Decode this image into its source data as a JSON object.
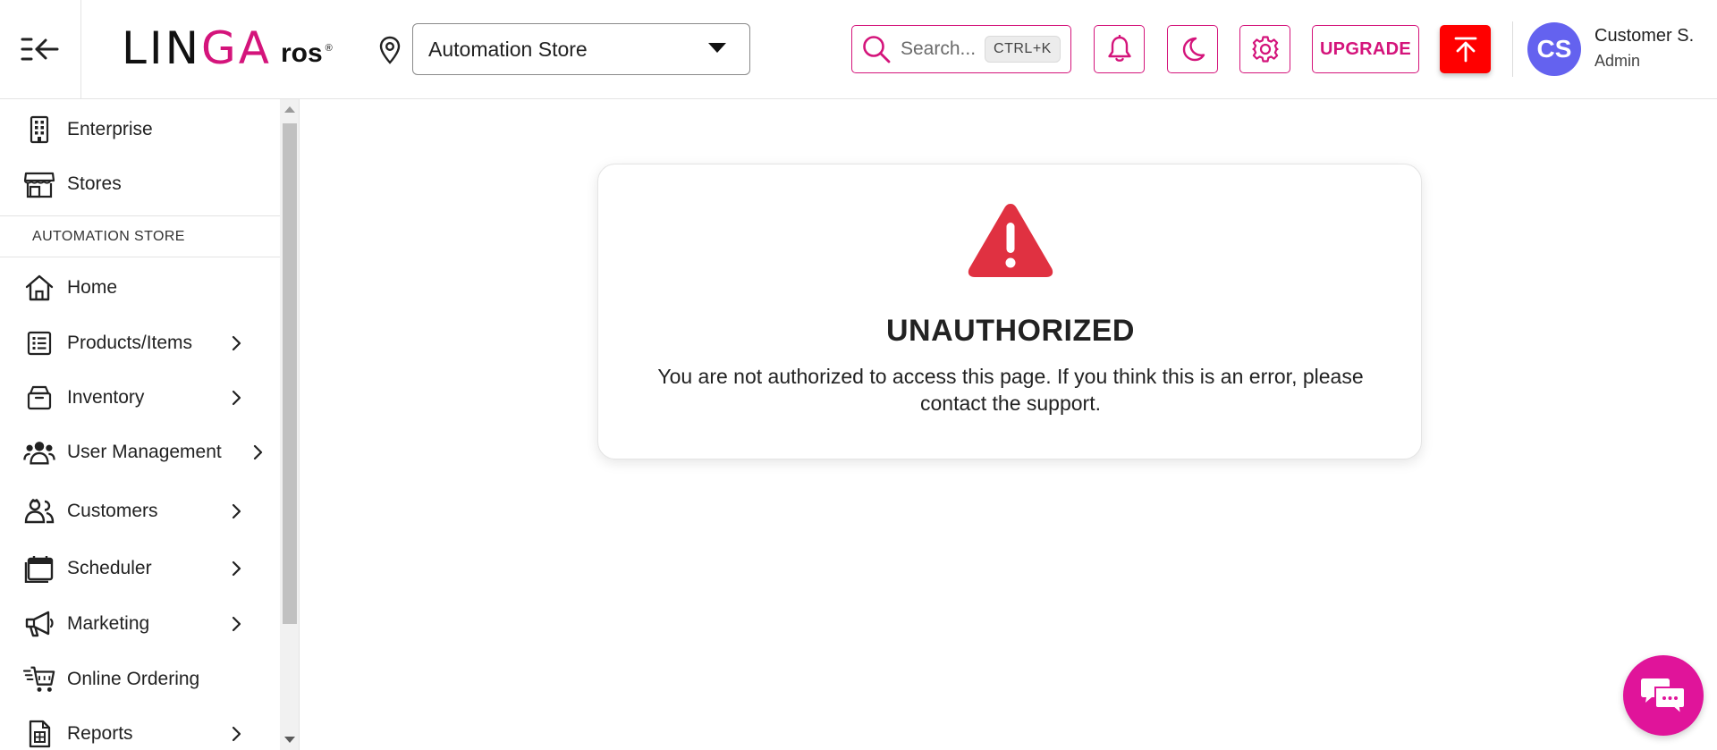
{
  "colors": {
    "brand": "#d4147b",
    "danger": "#e03141",
    "upload": "#ff0000",
    "avatar": "#6462ef",
    "chat": "#e0149a"
  },
  "header": {
    "logo": {
      "brand": "LINGA",
      "suffix": "ros",
      "reg": "®"
    },
    "store_select": {
      "value": "Automation Store"
    },
    "search": {
      "placeholder": "Search...",
      "shortcut": "CTRL+K"
    },
    "upgrade_label": "UPGRADE",
    "user": {
      "initials": "CS",
      "name": "Customer S.",
      "role": "Admin"
    }
  },
  "sidebar": {
    "top_items": [
      {
        "label": "Enterprise",
        "icon": "building-icon"
      },
      {
        "label": "Stores",
        "icon": "store-icon"
      }
    ],
    "section_title": "AUTOMATION STORE",
    "items": [
      {
        "label": "Home",
        "icon": "home-icon",
        "has_children": false
      },
      {
        "label": "Products/Items",
        "icon": "list-icon",
        "has_children": true
      },
      {
        "label": "Inventory",
        "icon": "box-icon",
        "has_children": true
      },
      {
        "label": "User Management",
        "icon": "users-icon",
        "has_children": true
      },
      {
        "label": "Customers",
        "icon": "customers-icon",
        "has_children": true
      },
      {
        "label": "Scheduler",
        "icon": "calendar-icon",
        "has_children": true
      },
      {
        "label": "Marketing",
        "icon": "megaphone-icon",
        "has_children": true
      },
      {
        "label": "Online Ordering",
        "icon": "cart-icon",
        "has_children": false
      },
      {
        "label": "Reports",
        "icon": "report-icon",
        "has_children": true
      }
    ]
  },
  "main": {
    "error": {
      "icon": "warning-triangle-icon",
      "title": "UNAUTHORIZED",
      "message": "You are not authorized to access this page. If you think this is an error, please contact the support."
    }
  }
}
